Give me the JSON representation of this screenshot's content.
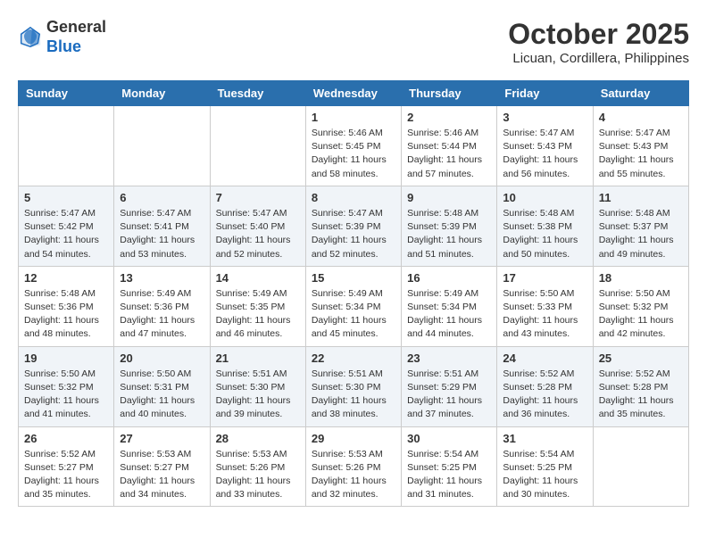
{
  "header": {
    "logo": {
      "line1": "General",
      "line2": "Blue"
    },
    "title": "October 2025",
    "location": "Licuan, Cordillera, Philippines"
  },
  "weekdays": [
    "Sunday",
    "Monday",
    "Tuesday",
    "Wednesday",
    "Thursday",
    "Friday",
    "Saturday"
  ],
  "weeks": [
    {
      "days": [
        {
          "num": "",
          "info": ""
        },
        {
          "num": "",
          "info": ""
        },
        {
          "num": "",
          "info": ""
        },
        {
          "num": "1",
          "info": "Sunrise: 5:46 AM\nSunset: 5:45 PM\nDaylight: 11 hours\nand 58 minutes."
        },
        {
          "num": "2",
          "info": "Sunrise: 5:46 AM\nSunset: 5:44 PM\nDaylight: 11 hours\nand 57 minutes."
        },
        {
          "num": "3",
          "info": "Sunrise: 5:47 AM\nSunset: 5:43 PM\nDaylight: 11 hours\nand 56 minutes."
        },
        {
          "num": "4",
          "info": "Sunrise: 5:47 AM\nSunset: 5:43 PM\nDaylight: 11 hours\nand 55 minutes."
        }
      ]
    },
    {
      "days": [
        {
          "num": "5",
          "info": "Sunrise: 5:47 AM\nSunset: 5:42 PM\nDaylight: 11 hours\nand 54 minutes."
        },
        {
          "num": "6",
          "info": "Sunrise: 5:47 AM\nSunset: 5:41 PM\nDaylight: 11 hours\nand 53 minutes."
        },
        {
          "num": "7",
          "info": "Sunrise: 5:47 AM\nSunset: 5:40 PM\nDaylight: 11 hours\nand 52 minutes."
        },
        {
          "num": "8",
          "info": "Sunrise: 5:47 AM\nSunset: 5:39 PM\nDaylight: 11 hours\nand 52 minutes."
        },
        {
          "num": "9",
          "info": "Sunrise: 5:48 AM\nSunset: 5:39 PM\nDaylight: 11 hours\nand 51 minutes."
        },
        {
          "num": "10",
          "info": "Sunrise: 5:48 AM\nSunset: 5:38 PM\nDaylight: 11 hours\nand 50 minutes."
        },
        {
          "num": "11",
          "info": "Sunrise: 5:48 AM\nSunset: 5:37 PM\nDaylight: 11 hours\nand 49 minutes."
        }
      ]
    },
    {
      "days": [
        {
          "num": "12",
          "info": "Sunrise: 5:48 AM\nSunset: 5:36 PM\nDaylight: 11 hours\nand 48 minutes."
        },
        {
          "num": "13",
          "info": "Sunrise: 5:49 AM\nSunset: 5:36 PM\nDaylight: 11 hours\nand 47 minutes."
        },
        {
          "num": "14",
          "info": "Sunrise: 5:49 AM\nSunset: 5:35 PM\nDaylight: 11 hours\nand 46 minutes."
        },
        {
          "num": "15",
          "info": "Sunrise: 5:49 AM\nSunset: 5:34 PM\nDaylight: 11 hours\nand 45 minutes."
        },
        {
          "num": "16",
          "info": "Sunrise: 5:49 AM\nSunset: 5:34 PM\nDaylight: 11 hours\nand 44 minutes."
        },
        {
          "num": "17",
          "info": "Sunrise: 5:50 AM\nSunset: 5:33 PM\nDaylight: 11 hours\nand 43 minutes."
        },
        {
          "num": "18",
          "info": "Sunrise: 5:50 AM\nSunset: 5:32 PM\nDaylight: 11 hours\nand 42 minutes."
        }
      ]
    },
    {
      "days": [
        {
          "num": "19",
          "info": "Sunrise: 5:50 AM\nSunset: 5:32 PM\nDaylight: 11 hours\nand 41 minutes."
        },
        {
          "num": "20",
          "info": "Sunrise: 5:50 AM\nSunset: 5:31 PM\nDaylight: 11 hours\nand 40 minutes."
        },
        {
          "num": "21",
          "info": "Sunrise: 5:51 AM\nSunset: 5:30 PM\nDaylight: 11 hours\nand 39 minutes."
        },
        {
          "num": "22",
          "info": "Sunrise: 5:51 AM\nSunset: 5:30 PM\nDaylight: 11 hours\nand 38 minutes."
        },
        {
          "num": "23",
          "info": "Sunrise: 5:51 AM\nSunset: 5:29 PM\nDaylight: 11 hours\nand 37 minutes."
        },
        {
          "num": "24",
          "info": "Sunrise: 5:52 AM\nSunset: 5:28 PM\nDaylight: 11 hours\nand 36 minutes."
        },
        {
          "num": "25",
          "info": "Sunrise: 5:52 AM\nSunset: 5:28 PM\nDaylight: 11 hours\nand 35 minutes."
        }
      ]
    },
    {
      "days": [
        {
          "num": "26",
          "info": "Sunrise: 5:52 AM\nSunset: 5:27 PM\nDaylight: 11 hours\nand 35 minutes."
        },
        {
          "num": "27",
          "info": "Sunrise: 5:53 AM\nSunset: 5:27 PM\nDaylight: 11 hours\nand 34 minutes."
        },
        {
          "num": "28",
          "info": "Sunrise: 5:53 AM\nSunset: 5:26 PM\nDaylight: 11 hours\nand 33 minutes."
        },
        {
          "num": "29",
          "info": "Sunrise: 5:53 AM\nSunset: 5:26 PM\nDaylight: 11 hours\nand 32 minutes."
        },
        {
          "num": "30",
          "info": "Sunrise: 5:54 AM\nSunset: 5:25 PM\nDaylight: 11 hours\nand 31 minutes."
        },
        {
          "num": "31",
          "info": "Sunrise: 5:54 AM\nSunset: 5:25 PM\nDaylight: 11 hours\nand 30 minutes."
        },
        {
          "num": "",
          "info": ""
        }
      ]
    }
  ]
}
